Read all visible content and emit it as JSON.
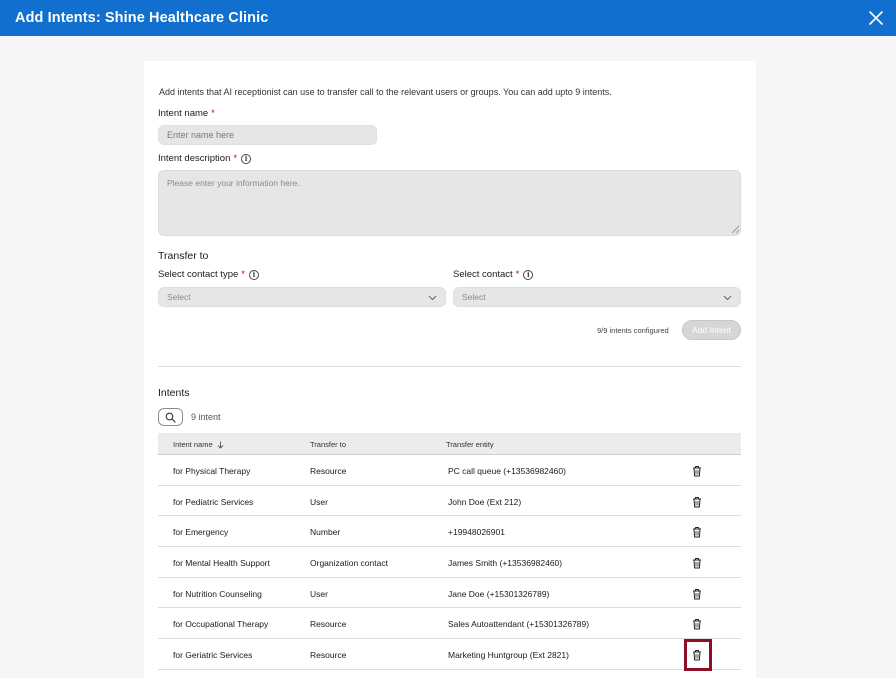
{
  "header": {
    "title": "Add Intents: Shine Healthcare Clinic"
  },
  "form": {
    "intro": "Add intents that AI receptionist can use to transfer call to the relevant users or groups. You can add upto 9 intents.",
    "intent_name_label": "Intent name",
    "intent_name_placeholder": "Enter name here",
    "intent_description_label": "Intent description",
    "intent_description_placeholder": "Please enter your information here.",
    "required_marker": "*",
    "transfer_to_title": "Transfer to",
    "contact_type_label": "Select contact type",
    "contact_type_value": "Select",
    "contact_label": "Select contact",
    "contact_value": "Select",
    "configured_text": "9/9 intents configured",
    "add_intent_label": "Add Intent"
  },
  "intents": {
    "title": "Intents",
    "count_text": "9 intent",
    "columns": [
      "Intent name",
      "Transfer to",
      "Transfer entity"
    ],
    "rows": [
      {
        "name": "for Physical Therapy",
        "transfer_to": "Resource",
        "entity": "PC call queue (+13536982460)"
      },
      {
        "name": "for Pediatric Services",
        "transfer_to": "User",
        "entity": "John Doe (Ext 212)"
      },
      {
        "name": "for Emergency",
        "transfer_to": "Number",
        "entity": "+19948026901"
      },
      {
        "name": "for Mental Health Support",
        "transfer_to": "Organization contact",
        "entity": "James Smith (+13536982460)"
      },
      {
        "name": "for Nutrition Counseling",
        "transfer_to": "User",
        "entity": "Jane Doe (+15301326789)"
      },
      {
        "name": "for Occupational Therapy",
        "transfer_to": "Resource",
        "entity": "Sales Autoattendant (+15301326789)"
      },
      {
        "name": "for Geriatric Services",
        "transfer_to": "Resource",
        "entity": "Marketing Huntgroup (Ext 2821)"
      }
    ]
  },
  "icons": {
    "close": "close-icon",
    "info": "info-icon",
    "chevron": "chevron-down-icon",
    "search": "search-icon",
    "sort": "arrow-down-icon",
    "delete": "trash-icon"
  },
  "colors": {
    "header": "#1170cf",
    "highlight": "#8e0e25",
    "required": "#d0021b"
  }
}
